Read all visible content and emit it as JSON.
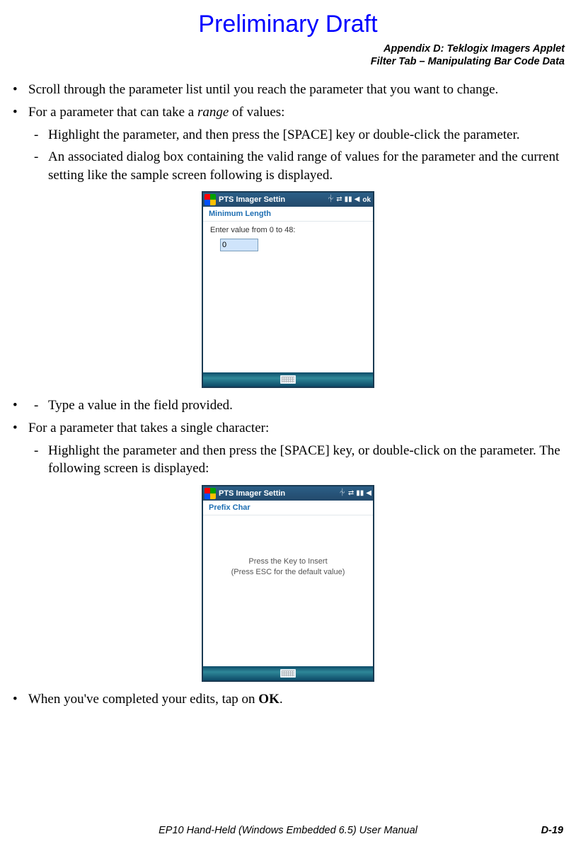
{
  "draft_watermark": "Preliminary Draft",
  "header": {
    "line1": "Appendix D:  Teklogix Imagers Applet",
    "line2": "Filter Tab – Manipulating Bar Code Data"
  },
  "content": {
    "b1": "Scroll through the parameter list until you reach the parameter that you want to change.",
    "b2_pre": "For a parameter that can take a ",
    "b2_em": "range",
    "b2_post": " of values:",
    "b2_s1": "Highlight the parameter, and then press the [SPACE] key or double-click the parameter.",
    "b2_s2": "An associated dialog box containing the valid range of values for the parameter and the current setting like the sample screen following is displayed.",
    "b2_s3": "Type a value in the field provided.",
    "b3": "For a parameter that takes a single character:",
    "b3_s1": "Highlight the parameter and then press the [SPACE] key, or double-click on the parameter. The following screen is displayed:",
    "b4_pre": "When you've completed your edits, tap on ",
    "b4_bold": "OK",
    "b4_post": "."
  },
  "shot1": {
    "title": "PTS Imager Settin",
    "ok": "ok",
    "subhead": "Minimum Length",
    "prompt": "Enter value from 0 to 48:",
    "value": "0"
  },
  "shot2": {
    "title": "PTS Imager Settin",
    "subhead": "Prefix Char",
    "line1": "Press the Key to Insert",
    "line2": "(Press ESC for the default value)"
  },
  "footer": {
    "text": "EP10 Hand-Held (Windows Embedded 6.5) User Manual",
    "page": "D-19"
  }
}
